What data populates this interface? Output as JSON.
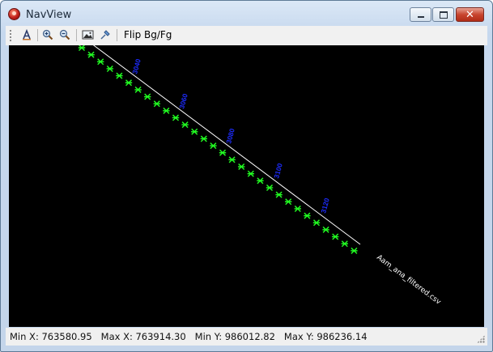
{
  "window": {
    "title": "NavView"
  },
  "toolbar": {
    "buttons": [
      "text-style-icon",
      "zoom-in-icon",
      "zoom-out-icon",
      "image-icon",
      "pin-icon"
    ],
    "flip_label": "Flip Bg/Fg"
  },
  "canvas": {
    "background": "#000000",
    "track_color": "#ffffff",
    "fix_color": "#22ff22",
    "label_color": "#1d2cff",
    "end_label": "Aam_ana_filtered.csv"
  },
  "status": {
    "min_x": "Min X: 763580.95",
    "max_x": "Max X: 763914.30",
    "min_y": "Min Y: 986012.82",
    "max_y": "Max Y: 986236.14"
  }
}
